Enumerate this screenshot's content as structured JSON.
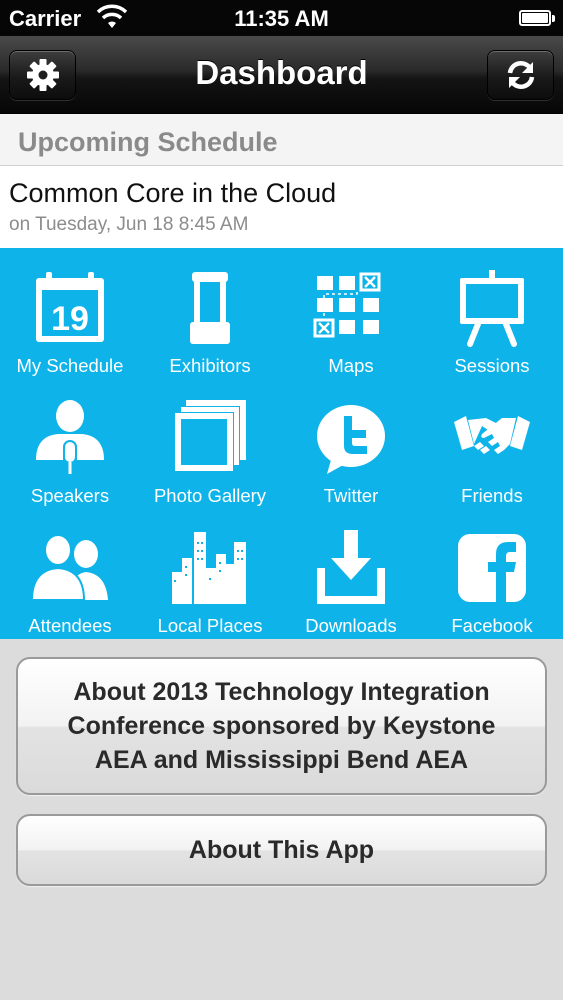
{
  "status_bar": {
    "carrier": "Carrier",
    "time": "11:35 AM",
    "battery_level": 1.0
  },
  "nav": {
    "title": "Dashboard",
    "left_icon": "gear-icon",
    "right_icon": "refresh-icon"
  },
  "upcoming": {
    "header": "Upcoming Schedule",
    "event_title": "Common Core in the Cloud",
    "event_date": "on Tuesday, Jun 18 8:45 AM"
  },
  "grid": {
    "background": "#0eb3ea",
    "calendar_day": "19",
    "items": [
      {
        "label": "My Schedule",
        "icon": "calendar-icon"
      },
      {
        "label": "Exhibitors",
        "icon": "exhibitor-booth-icon"
      },
      {
        "label": "Maps",
        "icon": "map-grid-icon"
      },
      {
        "label": "Sessions",
        "icon": "easel-icon"
      },
      {
        "label": "Speakers",
        "icon": "speaker-icon"
      },
      {
        "label": "Photo Gallery",
        "icon": "photo-gallery-icon"
      },
      {
        "label": "Twitter",
        "icon": "twitter-icon"
      },
      {
        "label": "Friends",
        "icon": "handshake-icon"
      },
      {
        "label": "Attendees",
        "icon": "attendees-icon"
      },
      {
        "label": "Local Places",
        "icon": "city-skyline-icon"
      },
      {
        "label": "Downloads",
        "icon": "download-icon"
      },
      {
        "label": "Facebook",
        "icon": "facebook-icon"
      }
    ]
  },
  "buttons": {
    "about_conference": "About 2013 Technology Integration Conference sponsored by Keystone AEA and Mississippi Bend AEA",
    "about_app": "About This App"
  }
}
